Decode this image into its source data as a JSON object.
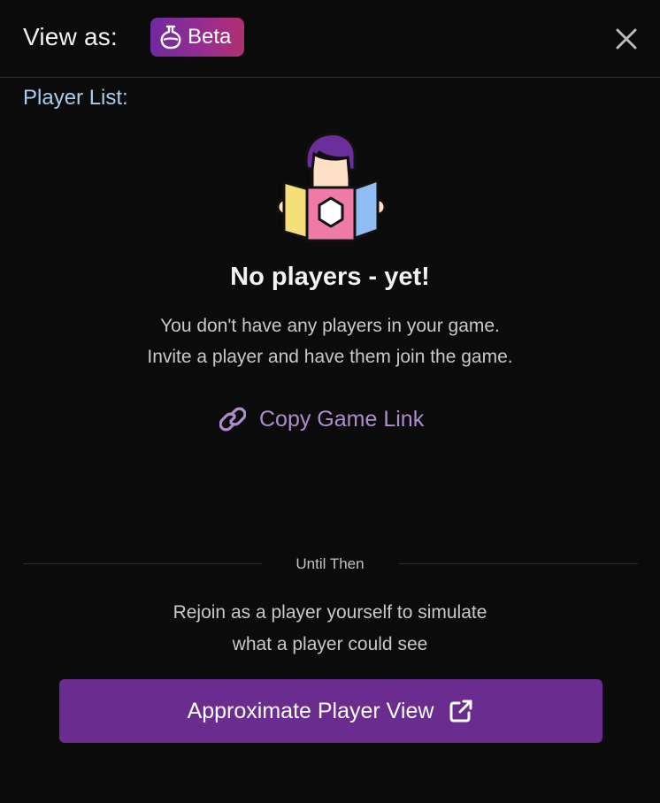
{
  "header": {
    "view_as_label": "View as:",
    "beta_badge": {
      "label": "Beta",
      "icon": "flask-icon"
    },
    "close_icon": "close-icon"
  },
  "player_list": {
    "label": "Player List:"
  },
  "empty_state": {
    "illustration": "player-reading-game-book-illustration",
    "title": "No players - yet!",
    "line1": "You don't have any players in your game.",
    "line2": "Invite a player and have them join the game.",
    "copy_link": {
      "label": "Copy Game Link",
      "icon": "link-icon"
    }
  },
  "until_then": {
    "divider_label": "Until Then",
    "line1": "Rejoin as a player yourself to simulate",
    "line2": "what a player could see",
    "button": {
      "label": "Approximate Player View",
      "icon": "external-link-icon"
    }
  },
  "colors": {
    "background": "#0b0b0c",
    "accent_purple": "#6a2c8e",
    "link_purple": "#b08ccf",
    "label_blue": "#a9cdf0",
    "badge_gradient_start": "#6f2aa0",
    "badge_gradient_end": "#b0306f"
  }
}
